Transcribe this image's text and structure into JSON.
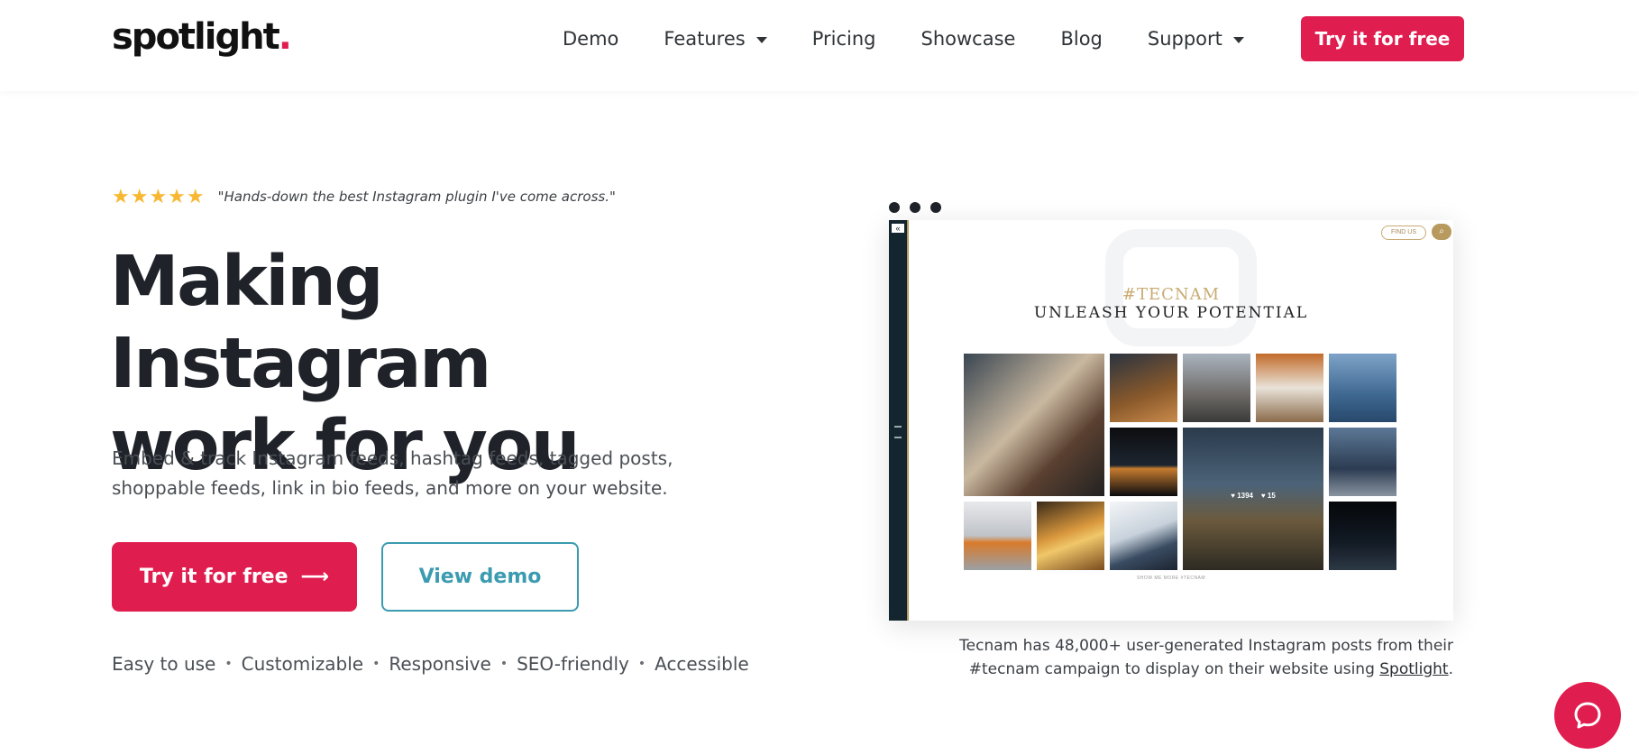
{
  "header": {
    "logo_text": "spotlight",
    "logo_dot": ".",
    "nav": [
      {
        "label": "Demo",
        "dropdown": false
      },
      {
        "label": "Features",
        "dropdown": true
      },
      {
        "label": "Pricing",
        "dropdown": false
      },
      {
        "label": "Showcase",
        "dropdown": false
      },
      {
        "label": "Blog",
        "dropdown": false
      },
      {
        "label": "Support",
        "dropdown": true
      }
    ],
    "cta_label": "Try it for free"
  },
  "hero": {
    "stars": "★★★★★",
    "quote": "\"Hands-down the best Instagram plugin I've come across.\"",
    "headline_line1": "Making Instagram",
    "headline_line2": "work for you",
    "subtext": "Embed & track Instagram feeds, hashtag feeds, tagged posts, shoppable feeds, link in bio feeds, and more on your website.",
    "primary_button": "Try it for free",
    "primary_arrow": "⟶",
    "secondary_button": "View demo",
    "features": [
      "Easy to use",
      "Customizable",
      "Responsive",
      "SEO-friendly",
      "Accessible"
    ],
    "feature_separator": "•"
  },
  "mockup": {
    "find_us": "FIND US",
    "tag": "#TECNAM",
    "slogan": "UNLEASH YOUR POTENTIAL",
    "likes": "♥ 1394",
    "comments": "♥ 15",
    "show_more": "SHOW ME MORE #TECNAM"
  },
  "caption": {
    "text": "Tecnam has 48,000+ user-generated Instagram posts from their #tecnam campaign to display on their website using ",
    "link": "Spotlight",
    "end": "."
  },
  "colors": {
    "accent": "#e01d4f",
    "secondary": "#3b9bb0",
    "star": "#f7b731",
    "gold": "#b89a5e"
  }
}
